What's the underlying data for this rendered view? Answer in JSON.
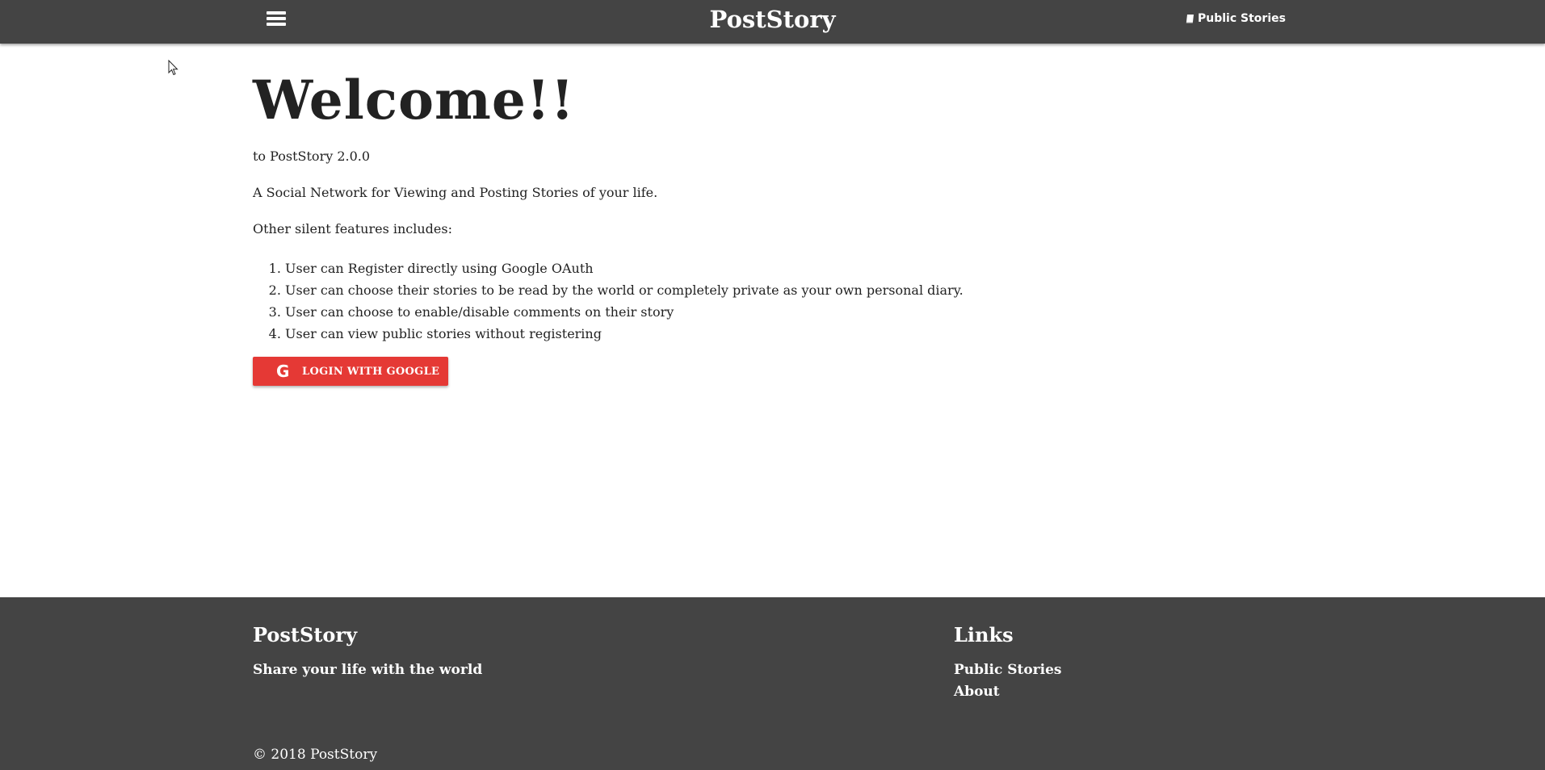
{
  "navbar": {
    "brand": "PostStory",
    "public_stories_link": "Public Stories",
    "menu_icon": "hamburger-menu-icon",
    "link_icon": "book-icon"
  },
  "main": {
    "title": "Welcome!!",
    "subtitle": "to PostStory 2.0.0",
    "description": "A Social Network for Viewing and Posting Stories of your life.",
    "features_intro": "Other silent features includes:",
    "features": [
      "User can Register directly using Google OAuth",
      "User can choose their stories to be read by the world or completely private as your own personal diary.",
      "User can choose to enable/disable comments on their story",
      "User can view public stories without registering"
    ],
    "login_button": "LOGIN WITH GOOGLE",
    "login_button_icon": "google-icon"
  },
  "footer": {
    "brand": "PostStory",
    "tagline": "Share your life with the world",
    "links_title": "Links",
    "links": [
      "Public Stories",
      "About"
    ],
    "copyright": "© 2018 PostStory"
  },
  "colors": {
    "navbar_bg": "#444444",
    "button_bg": "#e53935",
    "footer_bg": "#444444"
  }
}
